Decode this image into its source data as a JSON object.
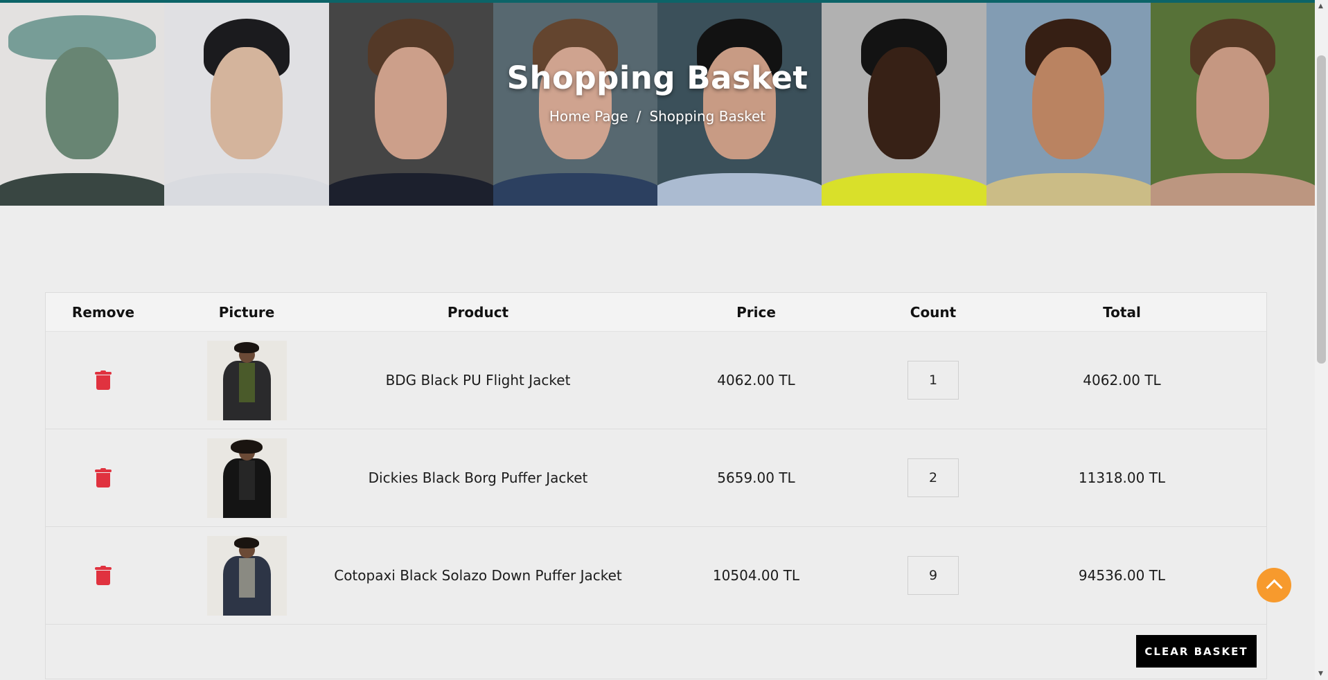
{
  "hero": {
    "title": "Shopping Basket",
    "breadcrumb": {
      "home": "Home Page",
      "separator": "/",
      "current": "Shopping Basket"
    }
  },
  "table": {
    "headers": {
      "remove": "Remove",
      "picture": "Picture",
      "product": "Product",
      "price": "Price",
      "count": "Count",
      "total": "Total"
    },
    "rows": [
      {
        "product": "BDG Black PU Flight Jacket",
        "price": "4062.00 TL",
        "count": "1",
        "total": "4062.00 TL"
      },
      {
        "product": "Dickies Black Borg Puffer Jacket",
        "price": "5659.00 TL",
        "count": "2",
        "total": "11318.00 TL"
      },
      {
        "product": "Cotopaxi Black Solazo Down Puffer Jacket",
        "price": "10504.00 TL",
        "count": "9",
        "total": "94536.00 TL"
      }
    ]
  },
  "actions": {
    "clear_basket": "CLEAR BASKET"
  },
  "colors": {
    "accent": "#0c6468",
    "remove": "#e0323f",
    "to_top": "#f79a2d",
    "button": "#000000"
  },
  "icons": {
    "remove": "trash-icon",
    "to_top": "chevron-up-icon"
  }
}
